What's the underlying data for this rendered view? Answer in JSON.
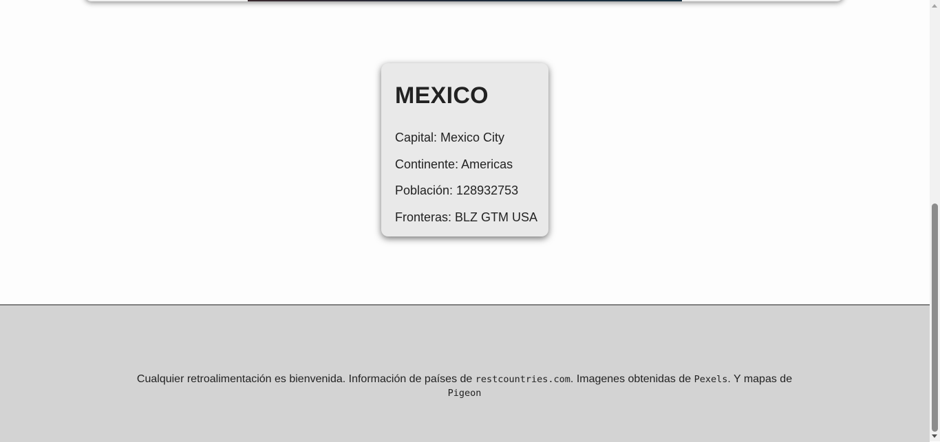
{
  "country_card": {
    "name": "MEXICO",
    "capital": "Capital: Mexico City",
    "continent": "Continente: Americas",
    "population": "Población: 128932753",
    "borders": "Fronteras: BLZ GTM USA"
  },
  "footer": {
    "text_1": "Cualquier retroalimentación es bienvenida. Información de países de ",
    "link_restcountries": "restcountries.com",
    "text_2": ". Imagenes obtenidas de ",
    "link_pexels": "Pexels",
    "text_3": ". Y mapas de ",
    "link_pigeon": "Pigeon"
  },
  "colors": {
    "page_background": "#fdfdfd",
    "card_background": "#e9e9e9",
    "footer_background": "#d3d3d3",
    "text": "#222222"
  },
  "icons": [
    "scroll-up-arrow-icon",
    "scroll-down-arrow-icon"
  ]
}
